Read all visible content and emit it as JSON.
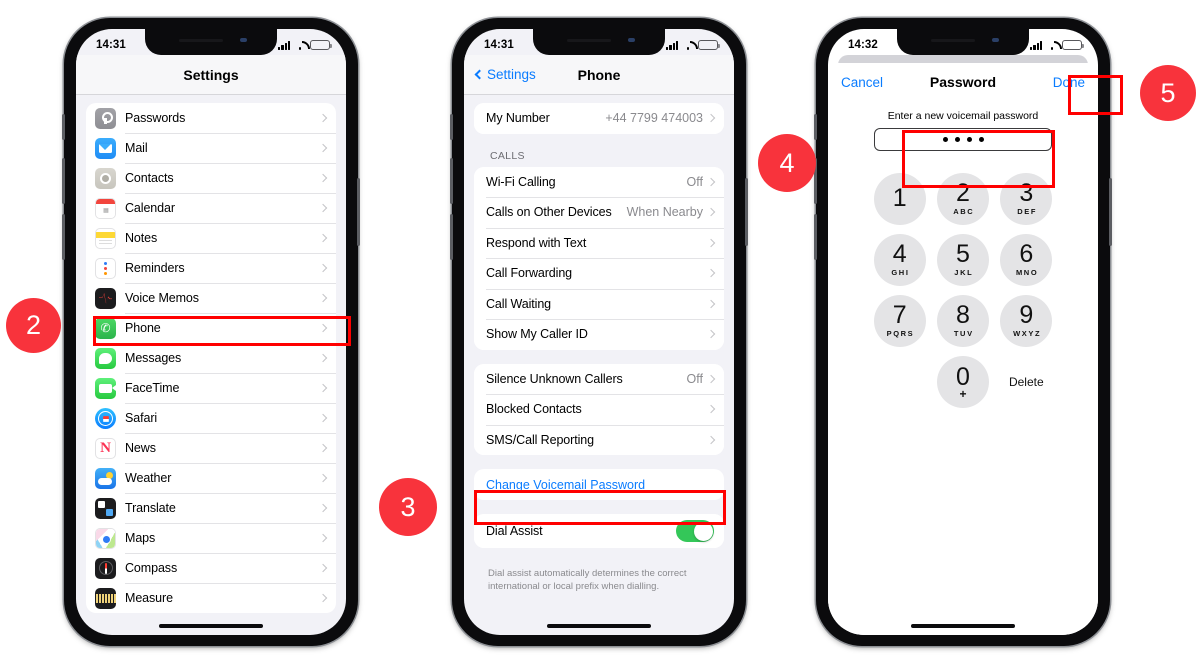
{
  "phones": [
    {
      "id": "settings",
      "status": {
        "time": "14:31",
        "signal_bars": 4,
        "wifi": "wifi-icon",
        "battery_level_pct": 28
      },
      "nav": {
        "title": "Settings",
        "back_label": ""
      },
      "groups": [
        {
          "rows": [
            {
              "label": "Passwords",
              "icon": "passwords-icon",
              "value": ""
            },
            {
              "label": "Mail",
              "icon": "mail-icon",
              "value": ""
            },
            {
              "label": "Contacts",
              "icon": "contacts-icon",
              "value": ""
            },
            {
              "label": "Calendar",
              "icon": "calendar-icon",
              "value": ""
            },
            {
              "label": "Notes",
              "icon": "notes-icon",
              "value": ""
            },
            {
              "label": "Reminders",
              "icon": "reminders-icon",
              "value": ""
            },
            {
              "label": "Voice Memos",
              "icon": "voice-memos-icon",
              "value": ""
            },
            {
              "label": "Phone",
              "icon": "phone-icon",
              "value": "",
              "highlighted": true
            },
            {
              "label": "Messages",
              "icon": "messages-icon",
              "value": ""
            },
            {
              "label": "FaceTime",
              "icon": "facetime-icon",
              "value": ""
            },
            {
              "label": "Safari",
              "icon": "safari-icon",
              "value": ""
            },
            {
              "label": "News",
              "icon": "news-icon",
              "value": ""
            },
            {
              "label": "Weather",
              "icon": "weather-icon",
              "value": ""
            },
            {
              "label": "Translate",
              "icon": "translate-icon",
              "value": ""
            },
            {
              "label": "Maps",
              "icon": "maps-icon",
              "value": ""
            },
            {
              "label": "Compass",
              "icon": "compass-icon",
              "value": ""
            },
            {
              "label": "Measure",
              "icon": "measure-icon",
              "value": ""
            }
          ]
        }
      ]
    },
    {
      "id": "phone-settings",
      "status": {
        "time": "14:31",
        "signal_bars": 4,
        "wifi": "wifi-icon",
        "battery_level_pct": 28
      },
      "nav": {
        "title": "Phone",
        "back_label": "Settings"
      },
      "my_number": {
        "label": "My Number",
        "value": "+44 7799 474003"
      },
      "calls_header": "CALLS",
      "calls_rows": [
        {
          "label": "Wi-Fi Calling",
          "value": "Off"
        },
        {
          "label": "Calls on Other Devices",
          "value": "When Nearby"
        },
        {
          "label": "Respond with Text",
          "value": ""
        },
        {
          "label": "Call Forwarding",
          "value": ""
        },
        {
          "label": "Call Waiting",
          "value": ""
        },
        {
          "label": "Show My Caller ID",
          "value": ""
        }
      ],
      "block_rows": [
        {
          "label": "Silence Unknown Callers",
          "value": "Off"
        },
        {
          "label": "Blocked Contacts",
          "value": ""
        },
        {
          "label": "SMS/Call Reporting",
          "value": ""
        }
      ],
      "change_voicemail": "Change Voicemail Password",
      "dial_assist": {
        "label": "Dial Assist",
        "enabled": true
      },
      "footnote": "Dial assist automatically determines the correct international or local prefix when dialling."
    },
    {
      "id": "password-modal",
      "status": {
        "time": "14:32",
        "signal_bars": 4,
        "wifi": "wifi-icon",
        "battery_level_pct": 28
      },
      "modal": {
        "cancel_label": "Cancel",
        "title": "Password",
        "done_label": "Done",
        "prompt": "Enter a new voicemail password",
        "entered_digits": 4
      },
      "keypad": [
        {
          "num": "1",
          "letters": ""
        },
        {
          "num": "2",
          "letters": "ABC"
        },
        {
          "num": "3",
          "letters": "DEF"
        },
        {
          "num": "4",
          "letters": "GHI"
        },
        {
          "num": "5",
          "letters": "JKL"
        },
        {
          "num": "6",
          "letters": "MNO"
        },
        {
          "num": "7",
          "letters": "PQRS"
        },
        {
          "num": "8",
          "letters": "TUV"
        },
        {
          "num": "9",
          "letters": "WXYZ"
        },
        {
          "num": "0",
          "letters": "+"
        }
      ],
      "delete_label": "Delete"
    }
  ],
  "badges": [
    {
      "number": "2"
    },
    {
      "number": "3"
    },
    {
      "number": "4"
    },
    {
      "number": "5"
    }
  ],
  "colors": {
    "accent_blue": "#0a7cff",
    "highlight_red": "#ff0000",
    "badge_red": "#f8333c",
    "toggle_green": "#34c759"
  }
}
